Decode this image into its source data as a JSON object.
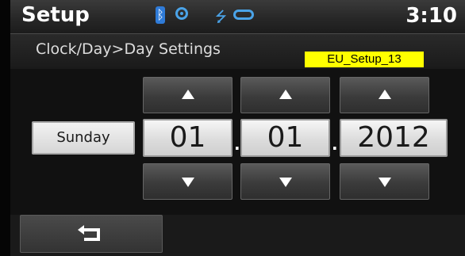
{
  "header": {
    "title": "Setup",
    "time": "3:10"
  },
  "status_icons": [
    "bluetooth-icon",
    "gps-icon",
    "usb-icon",
    "disc-icon"
  ],
  "page": {
    "breadcrumb": "Clock/Day>Day Settings",
    "screen_id": "EU_Setup_13"
  },
  "date": {
    "day_of_week": "Sunday",
    "day": "01",
    "month": "01",
    "year": "2012",
    "separator": "."
  },
  "colors": {
    "accent_icon": "#4aa3e8",
    "tag_bg": "#ffff00",
    "bg": "#111111"
  }
}
